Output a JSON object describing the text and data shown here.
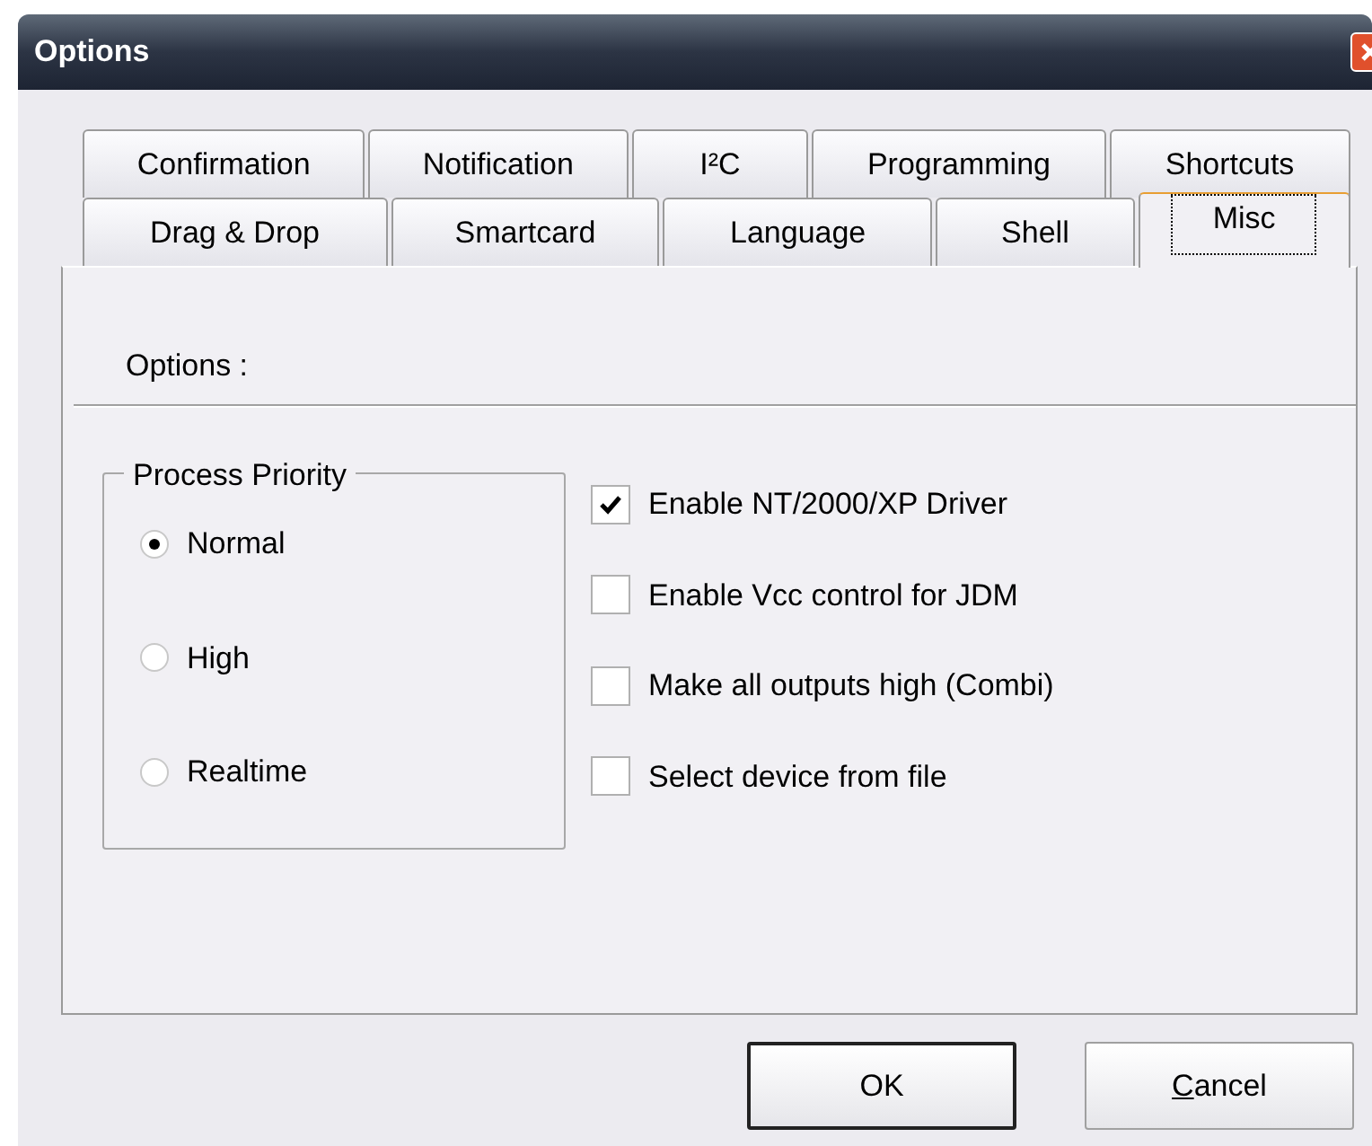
{
  "window": {
    "title": "Options"
  },
  "tab_rows": [
    {
      "tabs": [
        {
          "label": "Confirmation",
          "selected": false
        },
        {
          "label": "Notification",
          "selected": false
        },
        {
          "label": "I²C",
          "selected": false
        },
        {
          "label": "Programming",
          "selected": false
        },
        {
          "label": "Shortcuts",
          "selected": false
        }
      ]
    },
    {
      "tabs": [
        {
          "label": "Drag & Drop",
          "selected": false
        },
        {
          "label": "Smartcard",
          "selected": false
        },
        {
          "label": "Language",
          "selected": false
        },
        {
          "label": "Shell",
          "selected": false
        },
        {
          "label": "Misc",
          "selected": true
        }
      ]
    }
  ],
  "section_label": "Options :",
  "priority_group": {
    "title": "Process Priority",
    "options": [
      {
        "label": "Normal",
        "selected": true
      },
      {
        "label": "High",
        "selected": false
      },
      {
        "label": "Realtime",
        "selected": false
      }
    ]
  },
  "checkboxes": [
    {
      "label": "Enable NT/2000/XP Driver",
      "checked": true
    },
    {
      "label": "Enable Vcc control for JDM",
      "checked": false
    },
    {
      "label": "Make all outputs high (Combi)",
      "checked": false
    },
    {
      "label": "Select device from file",
      "checked": false
    }
  ],
  "buttons": [
    {
      "label": "OK",
      "default": true
    },
    {
      "label": "Cancel",
      "default": false,
      "mnemonic_underlined": true
    }
  ]
}
